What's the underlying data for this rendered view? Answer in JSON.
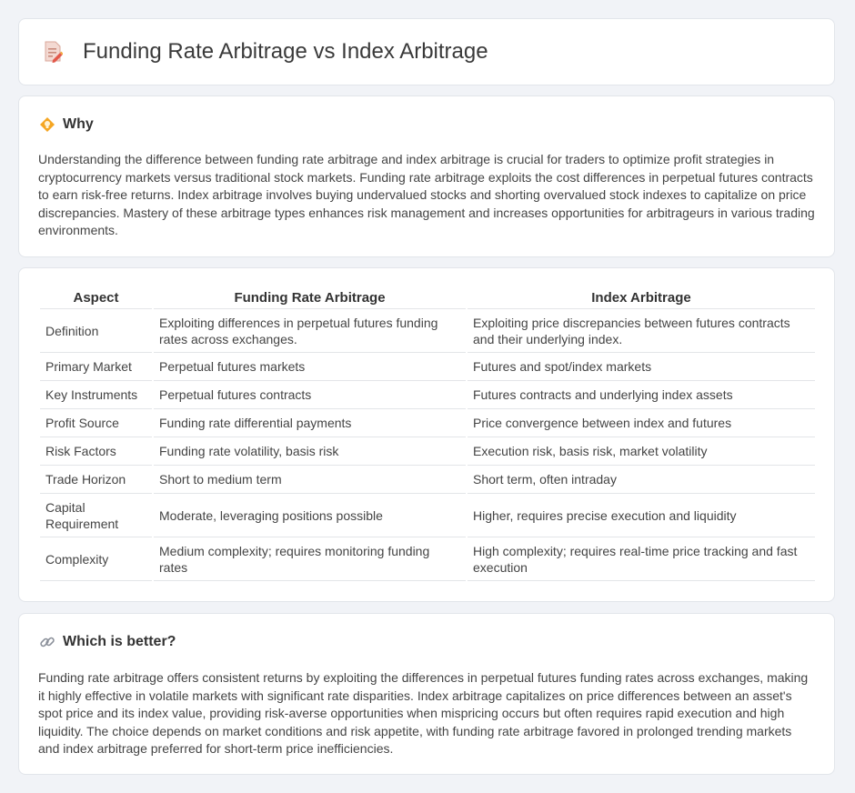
{
  "header": {
    "title": "Funding Rate Arbitrage vs Index Arbitrage",
    "icon": "document-pencil-icon"
  },
  "why": {
    "title": "Why",
    "icon": "diamond-bulb-icon",
    "text": "Understanding the difference between funding rate arbitrage and index arbitrage is crucial for traders to optimize profit strategies in cryptocurrency markets versus traditional stock markets. Funding rate arbitrage exploits the cost differences in perpetual futures contracts to earn risk-free returns. Index arbitrage involves buying undervalued stocks and shorting overvalued stock indexes to capitalize on price discrepancies. Mastery of these arbitrage types enhances risk management and increases opportunities for arbitrageurs in various trading environments."
  },
  "table": {
    "headers": [
      "Aspect",
      "Funding Rate Arbitrage",
      "Index Arbitrage"
    ],
    "rows": [
      [
        "Definition",
        "Exploiting differences in perpetual futures funding rates across exchanges.",
        "Exploiting price discrepancies between futures contracts and their underlying index."
      ],
      [
        "Primary Market",
        "Perpetual futures markets",
        "Futures and spot/index markets"
      ],
      [
        "Key Instruments",
        "Perpetual futures contracts",
        "Futures contracts and underlying index assets"
      ],
      [
        "Profit Source",
        "Funding rate differential payments",
        "Price convergence between index and futures"
      ],
      [
        "Risk Factors",
        "Funding rate volatility, basis risk",
        "Execution risk, basis risk, market volatility"
      ],
      [
        "Trade Horizon",
        "Short to medium term",
        "Short term, often intraday"
      ],
      [
        "Capital Requirement",
        "Moderate, leveraging positions possible",
        "Higher, requires precise execution and liquidity"
      ],
      [
        "Complexity",
        "Medium complexity; requires monitoring funding rates",
        "High complexity; requires real-time price tracking and fast execution"
      ]
    ]
  },
  "better": {
    "title": "Which is better?",
    "icon": "link-icon",
    "text": "Funding rate arbitrage offers consistent returns by exploiting the differences in perpetual futures funding rates across exchanges, making it highly effective in volatile markets with significant rate disparities. Index arbitrage capitalizes on price differences between an asset's spot price and its index value, providing risk-averse opportunities when mispricing occurs but often requires rapid execution and high liquidity. The choice depends on market conditions and risk appetite, with funding rate arbitrage favored in prolonged trending markets and index arbitrage preferred for short-term price inefficiencies."
  }
}
